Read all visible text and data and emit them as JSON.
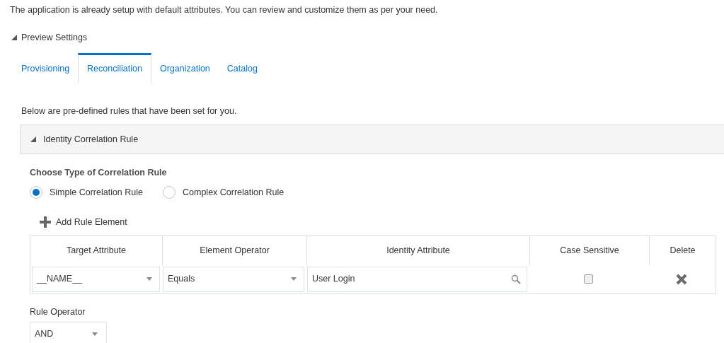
{
  "intro": "The application is already setup with default attributes. You can review and customize them as per your need.",
  "preview": {
    "label": "Preview Settings",
    "expanded": true
  },
  "tabs": [
    {
      "label": "Provisioning",
      "selected": false
    },
    {
      "label": "Reconciliation",
      "selected": true
    },
    {
      "label": "Organization",
      "selected": false
    },
    {
      "label": "Catalog",
      "selected": false
    }
  ],
  "note": "Below are pre-defined rules that have been set for you.",
  "section": {
    "label": "Identity Correlation Rule",
    "expanded": true
  },
  "rule_type": {
    "heading": "Choose Type of Correlation Rule",
    "options": [
      {
        "label": "Simple Correlation Rule",
        "selected": true
      },
      {
        "label": "Complex Correlation Rule",
        "selected": false
      }
    ]
  },
  "add_button": "Add Rule Element",
  "table": {
    "columns": [
      "Target Attribute",
      "Element Operator",
      "Identity Attribute",
      "Case Sensitive",
      "Delete"
    ],
    "rows": [
      {
        "target": "__NAME__",
        "operator": "Equals",
        "identity": "User Login",
        "case_sensitive": false
      }
    ]
  },
  "rule_operator": {
    "label": "Rule Operator",
    "value": "AND"
  }
}
